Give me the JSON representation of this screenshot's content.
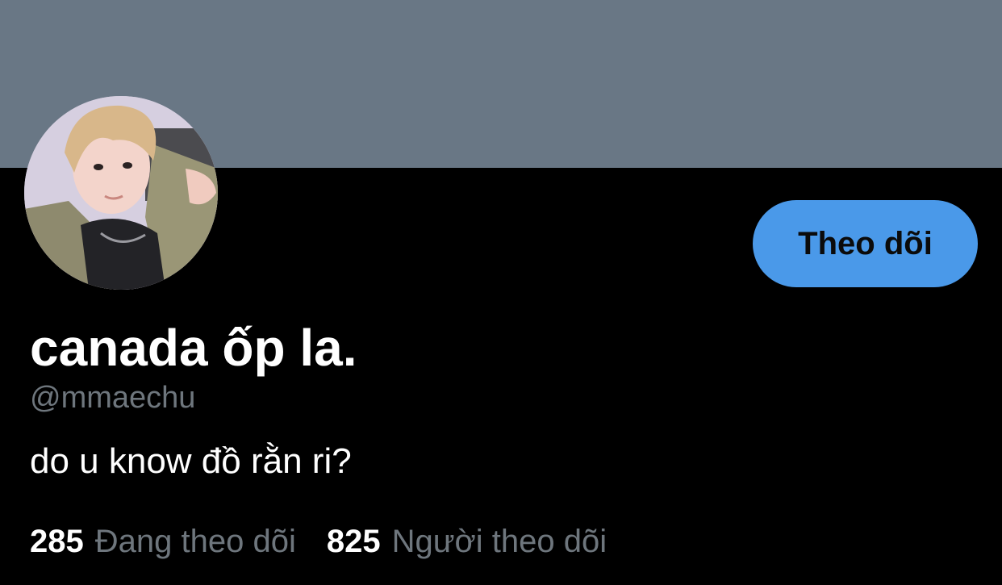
{
  "profile": {
    "display_name": "canada ốp la.",
    "handle": "@mmaechu",
    "bio": "do u know đồ rằn ri?",
    "follow_label": "Theo dõi",
    "avatar": "profile-photo"
  },
  "stats": {
    "following_count": "285",
    "following_label": "Đang theo dõi",
    "followers_count": "825",
    "followers_label": "Người theo dõi"
  },
  "colors": {
    "banner": "#697785",
    "background": "#000000",
    "accent": "#4a99e9",
    "secondary_text": "#6e767d",
    "primary_text": "#ffffff"
  }
}
